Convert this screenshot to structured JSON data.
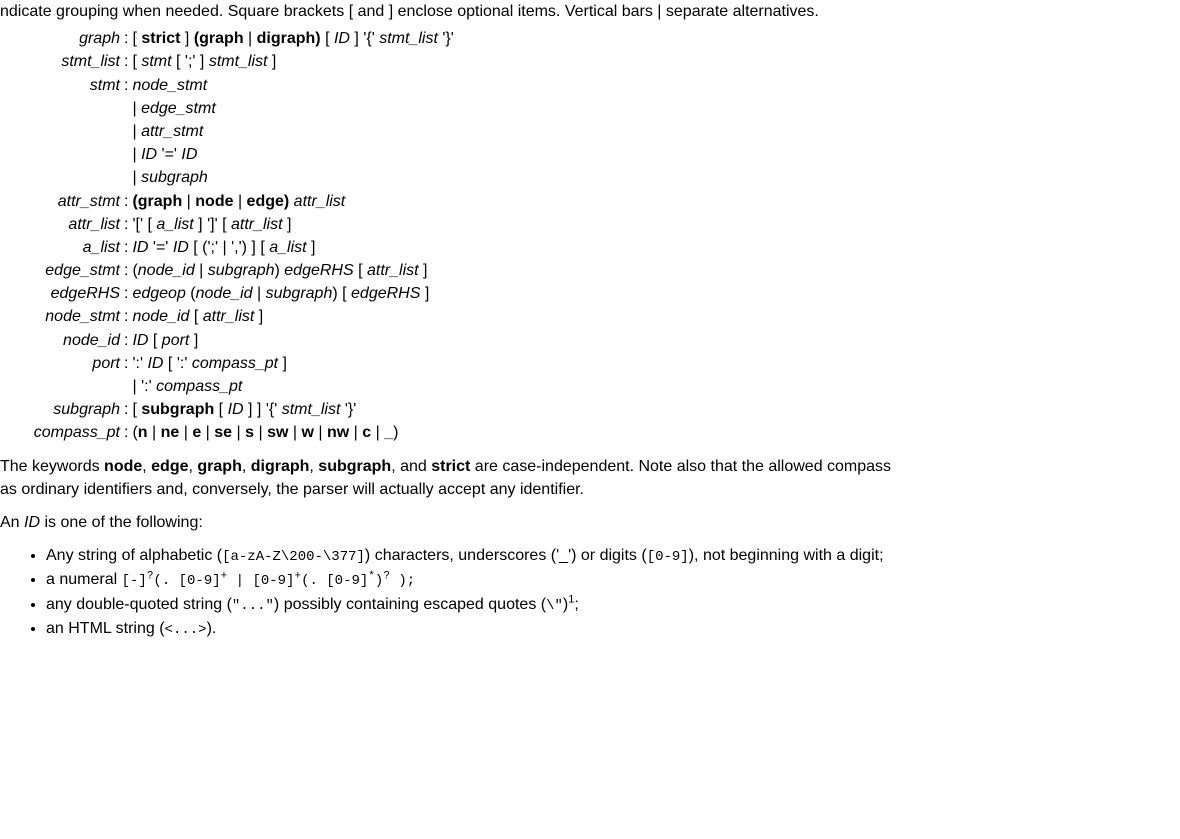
{
  "intro_frag": "ndicate grouping when needed. Square brackets [ and ] enclose optional items. Vertical bars | separate alternatives.",
  "grammar": [
    {
      "lhs": "graph",
      "rhs": [
        "[ <b>strict</b> ] <b>(graph</b> | <b>digraph)</b> [ <i>ID</i> ] <lit>'{'</lit> <i>stmt_list</i> <lit>'}'</lit>"
      ]
    },
    {
      "lhs": "stmt_list",
      "rhs": [
        "[ <i>stmt</i> [ <lit>';'</lit> ] <i>stmt_list</i> ]"
      ]
    },
    {
      "lhs": "stmt",
      "rhs": [
        "<i>node_stmt</i>",
        "| <i>edge_stmt</i>",
        "| <i>attr_stmt</i>",
        "| <i>ID</i> <lit>'='</lit> <i>ID</i>",
        "| <i>subgraph</i>"
      ]
    },
    {
      "lhs": "attr_stmt",
      "rhs": [
        "<b>(graph</b> | <b>node</b> | <b>edge)</b> <i>attr_list</i>"
      ]
    },
    {
      "lhs": "attr_list",
      "rhs": [
        "<lit>'['</lit> [ <i>a_list</i> ] <lit>']'</lit> [ <i>attr_list</i> ]"
      ]
    },
    {
      "lhs": "a_list",
      "rhs": [
        "<i>ID</i> <lit>'='</lit> <i>ID</i> [ (<lit>';'</lit> | <lit>','</lit>) ] [ <i>a_list</i> ]"
      ]
    },
    {
      "lhs": "edge_stmt",
      "rhs": [
        "(<i>node_id</i> | <i>subgraph</i>) <i>edgeRHS</i> [ <i>attr_list</i> ]"
      ]
    },
    {
      "lhs": "edgeRHS",
      "rhs": [
        "<i>edgeop</i> (<i>node_id</i> | <i>subgraph</i>) [ <i>edgeRHS</i> ]"
      ]
    },
    {
      "lhs": "node_stmt",
      "rhs": [
        "<i>node_id</i> [ <i>attr_list</i> ]"
      ]
    },
    {
      "lhs": "node_id",
      "rhs": [
        "<i>ID</i> [ <i>port</i> ]"
      ]
    },
    {
      "lhs": "port",
      "rhs": [
        "<lit>':'</lit> <i>ID</i> [ <lit>':'</lit> <i>compass_pt</i> ]",
        "| <lit>':'</lit> <i>compass_pt</i>"
      ]
    },
    {
      "lhs": "subgraph",
      "rhs": [
        "[ <b>subgraph</b> [ <i>ID</i> ] ] <lit>'{'</lit> <i>stmt_list</i> <lit>'}'</lit>"
      ]
    },
    {
      "lhs": "compass_pt",
      "rhs": [
        "(<b>n</b> | <b>ne</b> | <b>e</b> | <b>se</b> | <b>s</b> | <b>sw</b> | <b>w</b> | <b>nw</b> | <b>c</b> | <b>_</b>)"
      ]
    }
  ],
  "keywords_para_a": "The keywords ",
  "keywords_list": [
    "node",
    "edge",
    "graph",
    "digraph",
    "subgraph",
    "strict"
  ],
  "keywords_para_b": " are case-independent. Note also that the allowed compass",
  "keywords_para_line2": "as ordinary identifiers and, conversely, the parser will actually accept any identifier.",
  "id_intro_a": "An ",
  "id_intro_b": "ID",
  "id_intro_c": " is one of the following:",
  "id_bullets": {
    "b1_a": "Any string of alphabetic (",
    "b1_code1": "[a-zA-Z\\200-\\377]",
    "b1_b": ") characters, underscores (",
    "b1_c": "'_'",
    "b1_d": ") or digits (",
    "b1_code2": "[0-9]",
    "b1_e": "), not beginning with a digit;",
    "b2_a": "a numeral ",
    "b2_num": "[-]<sup>?</sup>(. [0-9]<sup>+</sup> | [0-9]<sup>+</sup>(. [0-9]<sup>*</sup>)<sup>?</sup> );",
    "b3_a": "any double-quoted string (",
    "b3_q": "\"...\"",
    "b3_b": ") possibly containing escaped quotes (",
    "b3_esc": "\\\"",
    "b3_c": ")",
    "b3_ref": "1",
    "b3_d": ";",
    "b4_a": "an HTML string (",
    "b4_h": "<...>",
    "b4_b": ")."
  }
}
